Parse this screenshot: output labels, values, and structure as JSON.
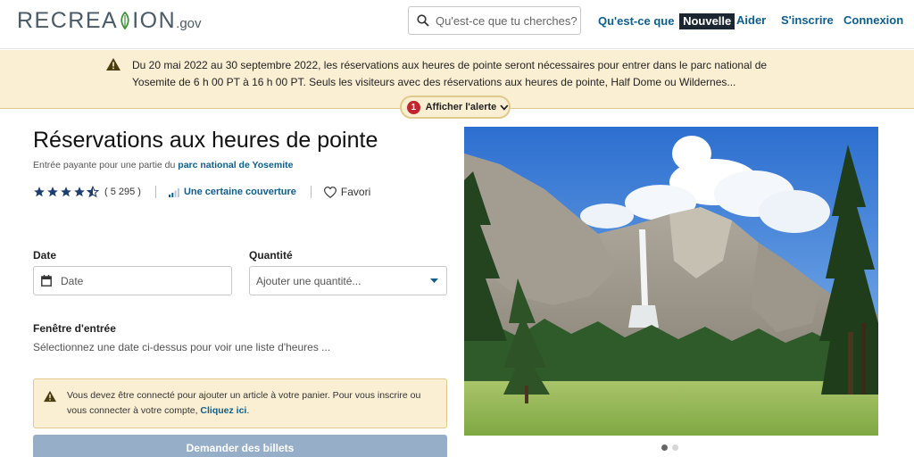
{
  "header": {
    "logo_main": "RECREATION",
    "logo_suffix": ".gov",
    "search_placeholder": "Qu'est-ce que tu cherches?",
    "nav": {
      "whats_new_prefix": "Qu'est-ce que",
      "whats_new_badge": "Nouvelle",
      "help": "Aider",
      "signup": "S'inscrire",
      "login": "Connexion"
    }
  },
  "alert": {
    "text": "Du 20 mai 2022 au 30 septembre 2022, les réservations aux heures de pointe seront nécessaires pour entrer dans le parc national de Yosemite de 6 h 00 PT à 16 h 00 PT. Seuls les visiteurs avec des réservations aux heures de pointe, Half Dome ou Wildernes...",
    "count": "1",
    "toggle_label": "Afficher l'alerte"
  },
  "listing": {
    "title": "Réservations aux heures de pointe",
    "subtitle_prefix": "Entrée payante pour une partie du",
    "subtitle_link": "parc national de Yosemite",
    "rating": 4.5,
    "review_count": "( 5 295 )",
    "coverage": "Une certaine couverture",
    "favorite": "Favori"
  },
  "form": {
    "date_label": "Date",
    "date_placeholder": "Date",
    "quantity_label": "Quantité",
    "quantity_placeholder": "Ajouter une quantité...",
    "window_label": "Fenêtre d'entrée",
    "window_help": "Sélectionnez une date ci-dessus pour voir une liste d'heures ..."
  },
  "login_notice": {
    "text": "Vous devez être connecté pour ajouter un article à votre panier. Pour vous inscrire ou vous connecter à votre compte,",
    "link": "Cliquez ici"
  },
  "request_button": "Demander des billets",
  "carousel": {
    "slide_count": 2,
    "active_slide": 1
  },
  "colors": {
    "link": "#0e5e8a",
    "alert_bg": "#fbefd3",
    "alert_border": "#e0c98c",
    "star": "#1c3d6e",
    "button_disabled": "#97aec9",
    "badge_bg": "#1c2633",
    "count_badge": "#c0262d"
  }
}
